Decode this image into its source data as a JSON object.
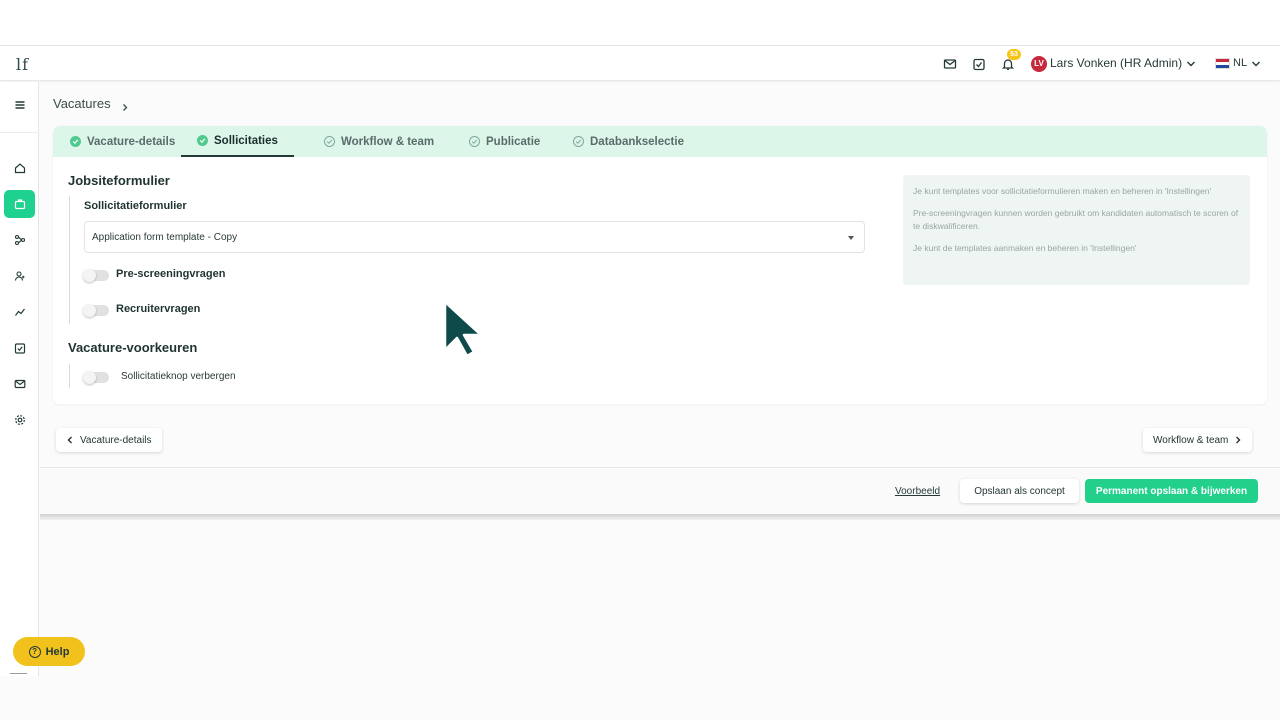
{
  "header": {
    "logo": "lf",
    "notification_count": "53",
    "user_initials": "LV",
    "user_name": "Lars Vonken (HR Admin)",
    "language": "NL",
    "icons": [
      "mail-icon",
      "task-icon",
      "bell-icon"
    ]
  },
  "sidebar": {
    "items": [
      "menu-icon",
      "home-icon",
      "briefcase-icon",
      "workflow-icon",
      "users-icon",
      "analytics-icon",
      "tasks-icon",
      "mail-icon",
      "settings-icon"
    ],
    "active": "briefcase-icon",
    "help_label": "Help"
  },
  "breadcrumb": {
    "label": "Vacatures"
  },
  "tabs": [
    {
      "label": "Vacature-details",
      "state": "done"
    },
    {
      "label": "Sollicitaties",
      "state": "active"
    },
    {
      "label": "Workflow & team",
      "state": "todo"
    },
    {
      "label": "Publicatie",
      "state": "todo"
    },
    {
      "label": "Databankselectie",
      "state": "todo"
    }
  ],
  "jobsite": {
    "title": "Jobsiteformulier",
    "form_label": "Sollicitatieformulier",
    "form_value": "Application form template - Copy",
    "toggle1_label": "Pre-screeningvragen",
    "toggle1_on": false,
    "toggle2_label": "Recruitervragen",
    "toggle2_on": false
  },
  "preferences": {
    "title": "Vacature-voorkeuren",
    "toggle_label": "Sollicitatieknop verbergen",
    "toggle_on": false
  },
  "info": {
    "line1": "Je kunt templates voor sollicitatieformulieren maken en beheren in 'Instellingen'",
    "line2": "Pre-screeningvragen kunnen worden gebruikt om kandidaten automatisch te scoren of te diskwalificeren.",
    "line3": "Je kunt de templates aanmaken en beheren in 'Instellingen'"
  },
  "navigation": {
    "prev_label": "Vacature-details",
    "next_label": "Workflow & team"
  },
  "footer": {
    "preview_label": "Voorbeeld",
    "save_draft_label": "Opslaan als concept",
    "save_permanent_label": "Permanent opslaan & bijwerken"
  },
  "colors": {
    "accent": "#22d08c",
    "tabs_bg": "#dcf6ea",
    "help": "#f1c21b",
    "avatar": "#c8283c"
  }
}
